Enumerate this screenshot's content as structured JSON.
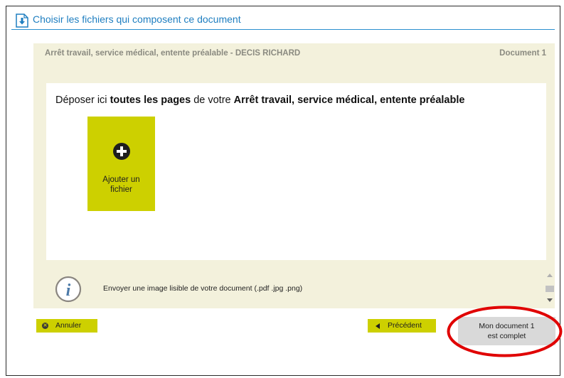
{
  "header": {
    "title": "Choisir les fichiers qui composent ce document",
    "icon": "download-document-icon"
  },
  "panel": {
    "title": "Arrêt travail, service médical, entente préalable - DECIS RICHARD",
    "doc_number": "Document 1",
    "dropzone": {
      "text_prefix": "Déposer ici ",
      "text_bold1": "toutes les pages",
      "text_middle": " de votre ",
      "text_bold2": "Arrêt travail, service médical, entente préalable",
      "add_file_line1": "Ajouter un",
      "add_file_line2": "fichier"
    },
    "info_text": "Envoyer une image lisible de votre document (.pdf .jpg .png)"
  },
  "buttons": {
    "cancel": "Annuler",
    "previous": "Précédent",
    "complete_line1": "Mon document 1",
    "complete_line2": "est complet"
  },
  "colors": {
    "accent_yellow": "#cdd000",
    "panel_bg": "#f3f1dc",
    "link_blue": "#1e7ec0",
    "highlight_red": "#e00000"
  }
}
